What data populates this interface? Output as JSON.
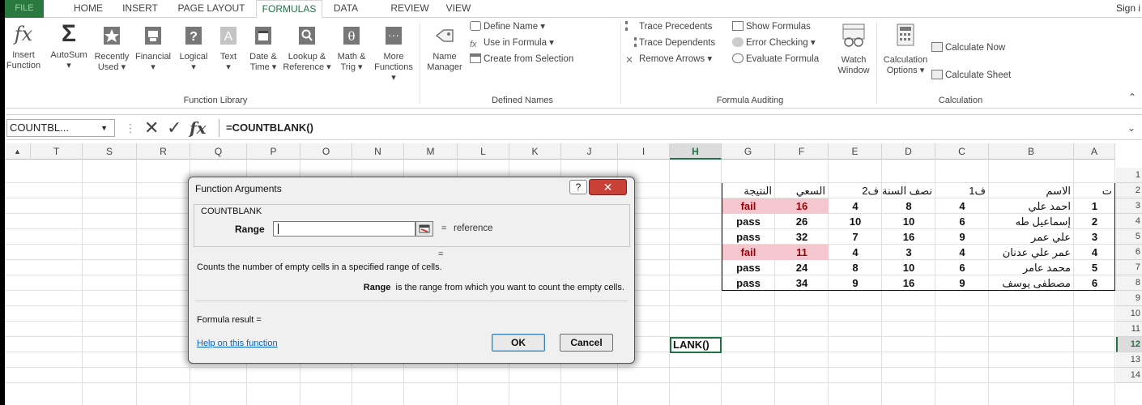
{
  "tabs": [
    {
      "label": "FILE"
    },
    {
      "label": "HOME"
    },
    {
      "label": "INSERT"
    },
    {
      "label": "PAGE LAYOUT"
    },
    {
      "label": "FORMULAS"
    },
    {
      "label": "DATA"
    },
    {
      "label": "REVIEW"
    },
    {
      "label": "VIEW"
    }
  ],
  "signin": "Sign i",
  "ribbon": {
    "function_library": {
      "group_label": "Function Library",
      "insert_function": [
        "Insert",
        "Function"
      ],
      "autosum": [
        "AutoSum",
        "▾"
      ],
      "recently_used": [
        "Recently",
        "Used ▾"
      ],
      "financial": [
        "Financial",
        "▾"
      ],
      "logical": [
        "Logical",
        "▾"
      ],
      "text": [
        "Text",
        "▾"
      ],
      "date_time": [
        "Date &",
        "Time ▾"
      ],
      "lookup_reference": [
        "Lookup &",
        "Reference ▾"
      ],
      "math_trig": [
        "Math &",
        "Trig ▾"
      ],
      "more_functions": [
        "More",
        "Functions ▾"
      ]
    },
    "defined_names": {
      "group_label": "Defined Names",
      "name_manager": [
        "Name",
        "Manager"
      ],
      "define_name": "Define Name ▾",
      "use_in_formula": "Use in Formula ▾",
      "create_from_selection": "Create from Selection"
    },
    "formula_auditing": {
      "group_label": "Formula Auditing",
      "trace_precedents": "Trace Precedents",
      "trace_dependents": "Trace Dependents",
      "remove_arrows": "Remove Arrows ▾",
      "show_formulas": "Show Formulas",
      "error_checking": "Error Checking ▾",
      "evaluate_formula": "Evaluate Formula",
      "watch_window": [
        "Watch",
        "Window"
      ]
    },
    "calculation": {
      "group_label": "Calculation",
      "calculation_options": [
        "Calculation",
        "Options ▾"
      ],
      "calculate_now": "Calculate Now",
      "calculate_sheet": "Calculate Sheet"
    }
  },
  "formula_bar": {
    "name_box": "COUNTBL...",
    "cancel_glyph": "✕",
    "enter_glyph": "✓",
    "fx_glyph": "fx",
    "formula": "=COUNTBLANK()"
  },
  "columns": [
    "T",
    "S",
    "R",
    "Q",
    "P",
    "O",
    "N",
    "M",
    "L",
    "K",
    "J",
    "I",
    "H",
    "G",
    "F",
    "E",
    "D",
    "C",
    "B",
    "A"
  ],
  "rows": [
    "1",
    "2",
    "3",
    "4",
    "5",
    "6",
    "7",
    "8",
    "9",
    "10",
    "11",
    "12",
    "13",
    "14"
  ],
  "table": {
    "headers": {
      "A": "ت",
      "B": "الاسم",
      "C": "ف1",
      "D": "نصف السنة",
      "E": "ف2",
      "F": "السعي",
      "G": "النتيجة"
    },
    "rows": [
      {
        "A": "1",
        "B": "احمد علي",
        "C": "4",
        "D": "8",
        "E": "4",
        "F": "16",
        "G": "fail",
        "fail": true
      },
      {
        "A": "2",
        "B": "إسماعيل طه",
        "C": "6",
        "D": "10",
        "E": "10",
        "F": "26",
        "G": "pass",
        "fail": false
      },
      {
        "A": "3",
        "B": "علي عمر",
        "C": "9",
        "D": "16",
        "E": "7",
        "F": "32",
        "G": "pass",
        "fail": false
      },
      {
        "A": "4",
        "B": "عمر علي عدنان",
        "C": "4",
        "D": "3",
        "E": "4",
        "F": "11",
        "G": "fail",
        "fail": true
      },
      {
        "A": "5",
        "B": "محمد عامر",
        "C": "6",
        "D": "10",
        "E": "8",
        "F": "24",
        "G": "pass",
        "fail": false
      },
      {
        "A": "6",
        "B": "مصطفى يوسف",
        "C": "9",
        "D": "16",
        "E": "9",
        "F": "34",
        "G": "pass",
        "fail": false
      }
    ]
  },
  "active_cell_text": "LANK()",
  "dialog": {
    "title": "Function Arguments",
    "help_glyph": "?",
    "close_glyph": "✕",
    "function_name": "COUNTBLANK",
    "arg_label": "Range",
    "arg_equals": "=",
    "arg_type": "reference",
    "result_equals": "=",
    "description": "Counts the number of empty cells in a specified range of cells.",
    "arg_desc_name": "Range",
    "arg_desc_text": "is the range from which you want to count the empty cells.",
    "formula_result": "Formula result =",
    "help_link": "Help on this function",
    "ok": "OK",
    "cancel": "Cancel"
  },
  "colors": {
    "accent": "#217346",
    "fail_fill": "#f4c7ce",
    "fail_text": "#9c0006",
    "close_red": "#c84036"
  }
}
